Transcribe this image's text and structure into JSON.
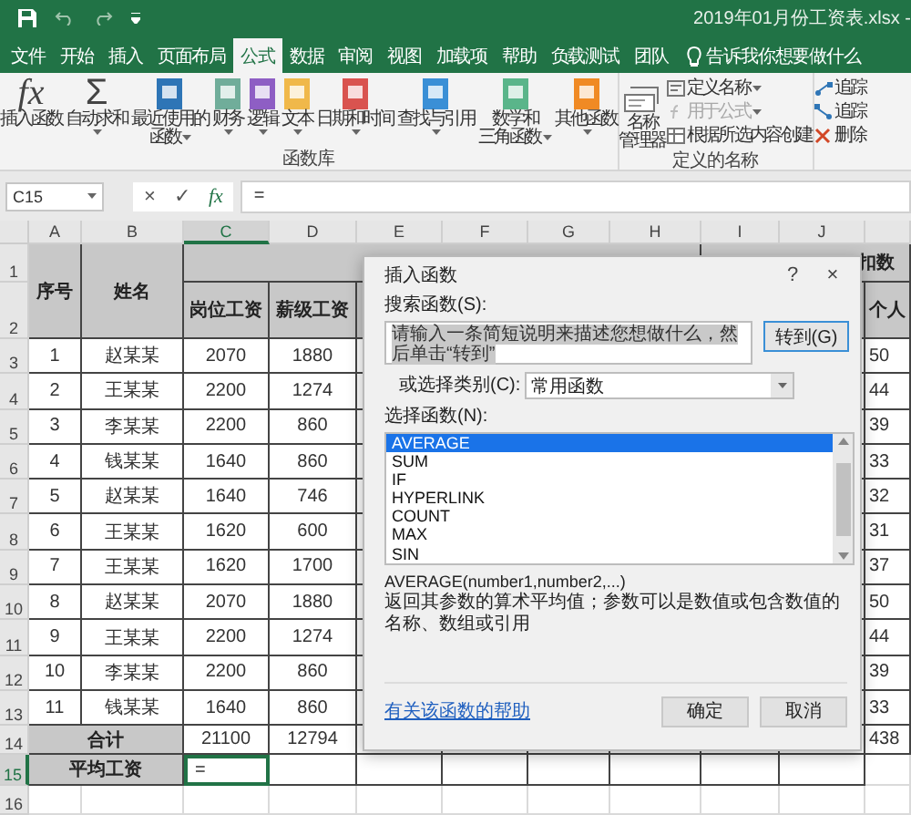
{
  "title_bar": {
    "title": "2019年01月份工资表.xlsx -"
  },
  "tabs": [
    {
      "label": "文件",
      "selected": false
    },
    {
      "label": "开始",
      "selected": false
    },
    {
      "label": "插入",
      "selected": false
    },
    {
      "label": "页面布局",
      "selected": false
    },
    {
      "label": "公式",
      "selected": true
    },
    {
      "label": "数据",
      "selected": false
    },
    {
      "label": "审阅",
      "selected": false
    },
    {
      "label": "视图",
      "selected": false
    },
    {
      "label": "加载项",
      "selected": false
    },
    {
      "label": "帮助",
      "selected": false
    },
    {
      "label": "负载测试",
      "selected": false
    },
    {
      "label": "团队",
      "selected": false
    }
  ],
  "tell_me": "告诉我你想要做什么",
  "ribbon": {
    "function_library": {
      "label": "函数库",
      "commands": [
        {
          "kind": "glyph-italic",
          "glyph": "fx",
          "lines": [
            "插入函数"
          ],
          "dropdown": false
        },
        {
          "kind": "glyph",
          "glyph": "Σ",
          "lines": [
            "自动求和"
          ],
          "dropdown": true
        },
        {
          "kind": "book",
          "color": "#2e75b6",
          "lines": [
            "最近使用的",
            "函数"
          ],
          "dropdown": true
        },
        {
          "kind": "book",
          "color": "#70ad9a",
          "lines": [
            "财务"
          ],
          "dropdown": true
        },
        {
          "kind": "book",
          "color": "#8e5ec4",
          "lines": [
            "逻辑"
          ],
          "dropdown": true
        },
        {
          "kind": "book",
          "color": "#f0b84a",
          "lines": [
            "文本"
          ],
          "dropdown": true
        },
        {
          "kind": "book",
          "color": "#d9534f",
          "lines": [
            "日期和时间"
          ],
          "dropdown": true
        },
        {
          "kind": "book",
          "color": "#3a8fd6",
          "lines": [
            "查找与引用"
          ],
          "dropdown": true
        },
        {
          "kind": "book",
          "color": "#5ab58a",
          "lines": [
            "数学和",
            "三角函数"
          ],
          "dropdown": true
        },
        {
          "kind": "book",
          "color": "#f08a24",
          "lines": [
            "其他函数"
          ],
          "dropdown": true
        }
      ]
    },
    "defined_names": {
      "label": "定义的名称",
      "manager": [
        "名称",
        "管理器"
      ],
      "items": [
        {
          "kind": "define",
          "label": "定义名称",
          "dropdown": true,
          "disabled": false
        },
        {
          "kind": "use",
          "label": "用于公式",
          "dropdown": true,
          "disabled": true
        },
        {
          "kind": "create",
          "label": "根据所选内容创建",
          "dropdown": false,
          "disabled": false
        }
      ]
    },
    "auditing": {
      "items": [
        {
          "kind": "precedents",
          "label": "追踪"
        },
        {
          "kind": "dependents",
          "label": "追踪"
        },
        {
          "kind": "remove",
          "label": "删除"
        }
      ]
    }
  },
  "formula_bar": {
    "name_box": "C15",
    "cancel": "×",
    "enter": "✓",
    "insert": "fx",
    "formula": "="
  },
  "sheet": {
    "columns": [
      {
        "label": "A",
        "selected": false
      },
      {
        "label": "B",
        "selected": false
      },
      {
        "label": "C",
        "selected": true
      },
      {
        "label": "D",
        "selected": false
      },
      {
        "label": "E",
        "selected": false
      },
      {
        "label": "F",
        "selected": false
      },
      {
        "label": "G",
        "selected": false
      },
      {
        "label": "H",
        "selected": false
      },
      {
        "label": "I",
        "selected": false
      },
      {
        "label": "J",
        "selected": false
      }
    ],
    "row_numbers": [
      {
        "label": "1",
        "selected": false
      },
      {
        "label": "2",
        "selected": false
      },
      {
        "label": "3",
        "selected": false
      },
      {
        "label": "4",
        "selected": false
      },
      {
        "label": "5",
        "selected": false
      },
      {
        "label": "6",
        "selected": false
      },
      {
        "label": "7",
        "selected": false
      },
      {
        "label": "8",
        "selected": false
      },
      {
        "label": "9",
        "selected": false
      },
      {
        "label": "10",
        "selected": false
      },
      {
        "label": "11",
        "selected": false
      },
      {
        "label": "12",
        "selected": false
      },
      {
        "label": "13",
        "selected": false
      },
      {
        "label": "14",
        "selected": false
      },
      {
        "label": "15",
        "selected": true
      },
      {
        "label": "16",
        "selected": false
      }
    ],
    "header": {
      "seq": "序号",
      "name": "姓名",
      "post_pay": "岗位工资",
      "grade_pay": "薪级工资",
      "deductions": "扣数",
      "column_k": "个人"
    },
    "records": [
      {
        "seq": "1",
        "name": "赵某某",
        "post_pay": "2070",
        "grade_pay": "1880",
        "column_k": "50"
      },
      {
        "seq": "2",
        "name": "王某某",
        "post_pay": "2200",
        "grade_pay": "1274",
        "column_k": "44"
      },
      {
        "seq": "3",
        "name": "李某某",
        "post_pay": "2200",
        "grade_pay": "860",
        "column_k": "39"
      },
      {
        "seq": "4",
        "name": "钱某某",
        "post_pay": "1640",
        "grade_pay": "860",
        "column_k": "33"
      },
      {
        "seq": "5",
        "name": "赵某某",
        "post_pay": "1640",
        "grade_pay": "746",
        "column_k": "32"
      },
      {
        "seq": "6",
        "name": "王某某",
        "post_pay": "1620",
        "grade_pay": "600",
        "column_k": "31"
      },
      {
        "seq": "7",
        "name": "王某某",
        "post_pay": "1620",
        "grade_pay": "1700",
        "column_k": "37"
      },
      {
        "seq": "8",
        "name": "赵某某",
        "post_pay": "2070",
        "grade_pay": "1880",
        "column_k": "50"
      },
      {
        "seq": "9",
        "name": "王某某",
        "post_pay": "2200",
        "grade_pay": "1274",
        "column_k": "44"
      },
      {
        "seq": "10",
        "name": "李某某",
        "post_pay": "2200",
        "grade_pay": "860",
        "column_k": "39"
      },
      {
        "seq": "11",
        "name": "钱某某",
        "post_pay": "1640",
        "grade_pay": "860",
        "column_k": "33"
      }
    ],
    "total": {
      "label": "合计",
      "post_pay": "21100",
      "grade_pay": "12794",
      "column_k": "438"
    },
    "average": {
      "label": "平均工资",
      "post_pay": "=",
      "selected": true
    }
  },
  "dialog": {
    "title": "插入函数",
    "help": "?",
    "close": "×",
    "search_label": "搜索函数(S):",
    "search_value": "请输入一条简短说明来描述您想做什么，然后单击“转到”",
    "search_text_selected": true,
    "go_button": "转到(G)",
    "category_label": "或选择类别(C):",
    "category_value": "常用函数",
    "list_label": "选择函数(N):",
    "functions": [
      {
        "name": "AVERAGE",
        "selected": true
      },
      {
        "name": "SUM",
        "selected": false
      },
      {
        "name": "IF",
        "selected": false
      },
      {
        "name": "HYPERLINK",
        "selected": false
      },
      {
        "name": "COUNT",
        "selected": false
      },
      {
        "name": "MAX",
        "selected": false
      },
      {
        "name": "SIN",
        "selected": false
      }
    ],
    "signature": "AVERAGE(number1,number2,...)",
    "description": "返回其参数的算术平均值；参数可以是数值或包含数值的名称、数组或引用",
    "help_link": "有关该函数的帮助",
    "buttons": [
      "确定",
      "取消"
    ]
  }
}
